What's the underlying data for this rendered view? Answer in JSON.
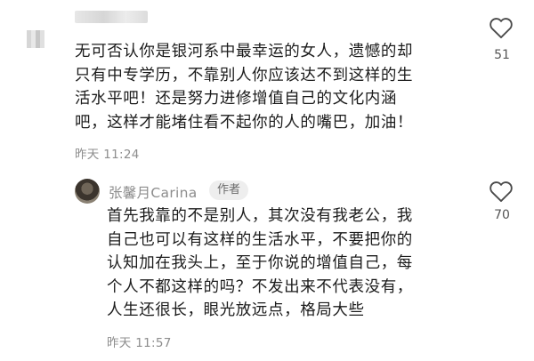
{
  "comment1": {
    "username": "",
    "text": "无可否认你是银河系中最幸运的女人，遗憾的却\n只有中专学历，不靠别人你应该达不到这样的生\n活水平吧！还是努力进修增值自己的文化内涵\n吧，这样才能堵住看不起你的人的嘴巴，加油！",
    "time": "昨天 11:24",
    "likes": "51"
  },
  "reply": {
    "username": "张馨月Carina",
    "badge": "作者",
    "text": "首先我靠的不是别人，其次没有我老公，我\n自己也可以有这样的生活水平，不要把你的\n认知加在我头上，至于你说的增值自己，每\n个人不都这样的吗？不发出来不代表没有，\n人生还很长，眼光放远点，格局大些",
    "time": "昨天 11:57",
    "likes": "70"
  },
  "icons": {
    "like": "heart-outline-icon"
  }
}
